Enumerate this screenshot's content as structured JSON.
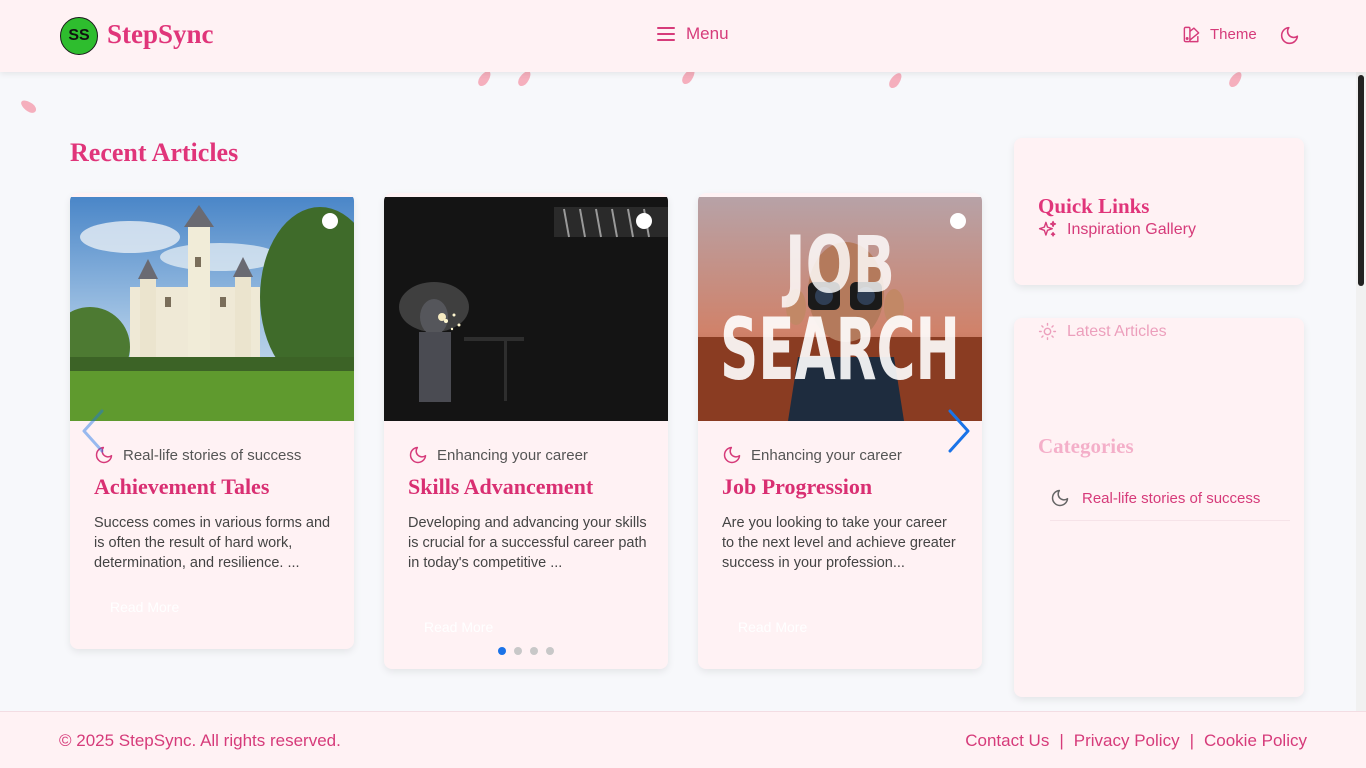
{
  "header": {
    "logo_initials": "SS",
    "logo_text": "StepSync",
    "menu_label": "Menu",
    "theme_label": "Theme"
  },
  "main": {
    "section_title": "Recent Articles",
    "articles": [
      {
        "category": "Real-life stories of success",
        "title": "Achievement Tales",
        "description": "Success comes in various forms and is often the result of hard work, determination, and resilience. ...",
        "read_more": "Read More"
      },
      {
        "category": "Enhancing your career",
        "title": "Skills Advancement",
        "description": "Developing and advancing your skills is crucial for a successful career path in today's competitive ...",
        "read_more": "Read More"
      },
      {
        "category": "Enhancing your career",
        "title": "Job Progression",
        "description": "Are you looking to take your career to the next level and achieve greater success in your profession...",
        "read_more": "Read More",
        "image_text_line1": "JOB",
        "image_text_line2": "SEARCH"
      }
    ],
    "carousel_pages": 4,
    "carousel_active_page": 1
  },
  "sidebar": {
    "quick_links_title": "Quick Links",
    "quick_link_gallery": "Inspiration Gallery",
    "latest_articles_label": "Latest Articles",
    "categories_title": "Categories",
    "category_item": "Real-life stories of success"
  },
  "footer": {
    "copyright": "© 2025 StepSync. All rights reserved.",
    "contact": "Contact Us",
    "privacy": "Privacy Policy",
    "cookie": "Cookie Policy",
    "separator": "|"
  },
  "colors": {
    "accent": "#e0357a",
    "header_bg": "#fff2f4",
    "page_bg": "#f7f8fb",
    "carousel_blue": "#1a73e8",
    "logo_green": "#2ebd2e"
  },
  "icons": {
    "menu": "hamburger-icon",
    "theme": "palette-icon",
    "dark_mode": "moon-icon",
    "category": "moon-icon",
    "gallery": "sparkles-icon",
    "latest": "sun-icon"
  }
}
